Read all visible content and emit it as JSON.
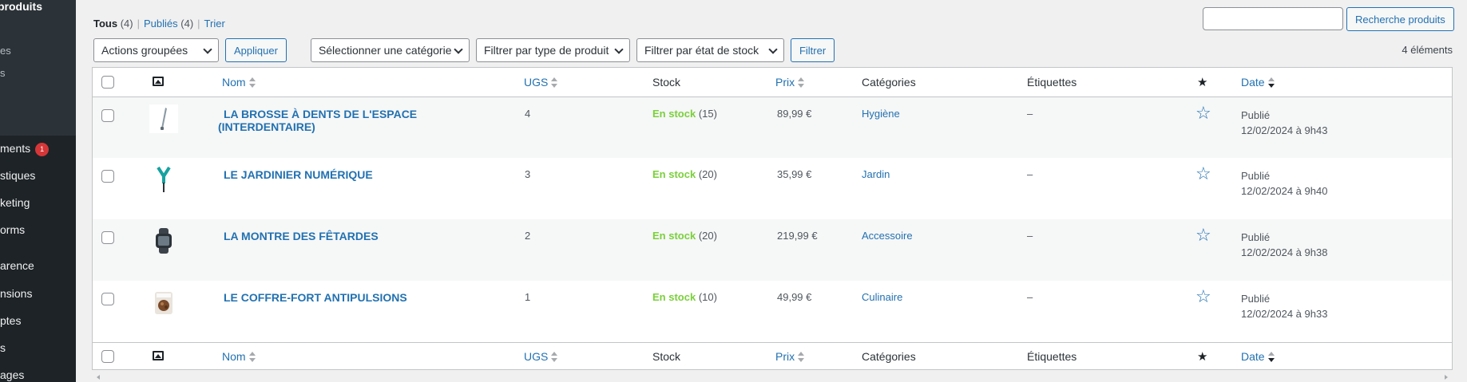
{
  "sidebar": {
    "submenu_title": "produits",
    "submenu_items": [
      "es",
      "s"
    ],
    "menu_items": [
      {
        "label": "ments",
        "badge": "1"
      },
      {
        "label": "stiques"
      },
      {
        "label": "keting"
      },
      {
        "label": "orms"
      },
      {
        "label": "arence"
      },
      {
        "label": "nsions"
      },
      {
        "label": "ptes"
      },
      {
        "label": "s"
      },
      {
        "label": "ages"
      }
    ]
  },
  "views": {
    "all_label": "Tous",
    "all_count": "(4)",
    "published_label": "Publiés",
    "published_count": "(4)",
    "sort_label": "Trier"
  },
  "search": {
    "value": "",
    "button_label": "Recherche produits"
  },
  "tablenav": {
    "bulk_actions": "Actions groupées",
    "apply_label": "Appliquer",
    "category_filter": "Sélectionner une catégorie",
    "type_filter": "Filtrer par type de produit",
    "stock_filter": "Filtrer par état de stock",
    "filter_label": "Filtrer",
    "count_label": "4 éléments"
  },
  "columns": {
    "name": "Nom",
    "sku": "UGS",
    "stock": "Stock",
    "price": "Prix",
    "categories": "Catégories",
    "tags": "Étiquettes",
    "date": "Date"
  },
  "products": [
    {
      "name": "LA BROSSE À DENTS DE L'ESPACE (INTERDENTAIRE)",
      "sku": "4",
      "stock_status": "En stock",
      "stock_qty": "(15)",
      "price": "89,99 €",
      "category": "Hygiène",
      "tags": "–",
      "status": "Publié",
      "date": "12/02/2024 à 9h43",
      "thumb": "toothbrush"
    },
    {
      "name": "LE JARDINIER NUMÉRIQUE",
      "sku": "3",
      "stock_status": "En stock",
      "stock_qty": "(20)",
      "price": "35,99 €",
      "category": "Jardin",
      "tags": "–",
      "status": "Publié",
      "date": "12/02/2024 à 9h40",
      "thumb": "garden-probe"
    },
    {
      "name": "LA MONTRE DES FÊTARDES",
      "sku": "2",
      "stock_status": "En stock",
      "stock_qty": "(20)",
      "price": "219,99 €",
      "category": "Accessoire",
      "tags": "–",
      "status": "Publié",
      "date": "12/02/2024 à 9h38",
      "thumb": "watch"
    },
    {
      "name": "LE COFFRE-FORT ANTIPULSIONS",
      "sku": "1",
      "stock_status": "En stock",
      "stock_qty": "(10)",
      "price": "49,99 €",
      "category": "Culinaire",
      "tags": "–",
      "status": "Publié",
      "date": "12/02/2024 à 9h33",
      "thumb": "safe-box"
    }
  ],
  "colors": {
    "accent": "#2271b1",
    "instock": "#7ad03a",
    "sidebar_bg": "#1d2327",
    "badge": "#d63638"
  },
  "icons": {
    "image_col": "image-icon",
    "featured_col": "star-icon",
    "sort": "sort-arrows-icon"
  }
}
